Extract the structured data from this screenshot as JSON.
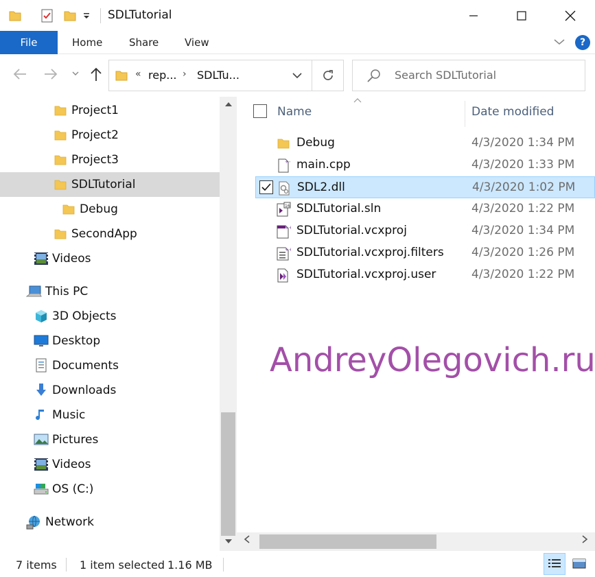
{
  "window": {
    "title": "SDLTutorial"
  },
  "ribbon": {
    "tabs": {
      "file": "File",
      "home": "Home",
      "share": "Share",
      "view": "View"
    },
    "help": "?"
  },
  "address": {
    "overflow": "«",
    "segments": [
      "rep...",
      "SDLTu..."
    ],
    "separator": "›"
  },
  "search": {
    "placeholder": "Search SDLTutorial"
  },
  "nav": {
    "items": [
      {
        "label": "Project1",
        "icon": "folder-icon"
      },
      {
        "label": "Project2",
        "icon": "folder-icon"
      },
      {
        "label": "Project3",
        "icon": "folder-icon"
      },
      {
        "label": "SDLTutorial",
        "icon": "folder-icon",
        "selected": true
      },
      {
        "label": "Debug",
        "icon": "folder-icon"
      },
      {
        "label": "SecondApp",
        "icon": "folder-icon"
      },
      {
        "label": "Videos",
        "icon": "videos-icon"
      },
      {
        "label": "This PC",
        "icon": "computer-icon"
      },
      {
        "label": "3D Objects",
        "icon": "3d-objects-icon"
      },
      {
        "label": "Desktop",
        "icon": "desktop-icon"
      },
      {
        "label": "Documents",
        "icon": "documents-icon"
      },
      {
        "label": "Downloads",
        "icon": "downloads-icon"
      },
      {
        "label": "Music",
        "icon": "music-icon"
      },
      {
        "label": "Pictures",
        "icon": "pictures-icon"
      },
      {
        "label": "Videos",
        "icon": "videos-icon"
      },
      {
        "label": "OS (C:)",
        "icon": "drive-icon"
      },
      {
        "label": "Network",
        "icon": "network-icon"
      }
    ]
  },
  "columns": {
    "name": "Name",
    "date": "Date modified"
  },
  "files": [
    {
      "name": "Debug",
      "date": "4/3/2020 1:34 PM",
      "icon": "folder-icon"
    },
    {
      "name": "main.cpp",
      "date": "4/3/2020 1:33 PM",
      "icon": "cpp-file-icon"
    },
    {
      "name": "SDL2.dll",
      "date": "4/3/2020 1:02 PM",
      "icon": "dll-file-icon",
      "selected": true
    },
    {
      "name": "SDLTutorial.sln",
      "date": "4/3/2020 1:22 PM",
      "icon": "solution-file-icon"
    },
    {
      "name": "SDLTutorial.vcxproj",
      "date": "4/3/2020 1:34 PM",
      "icon": "project-file-icon"
    },
    {
      "name": "SDLTutorial.vcxproj.filters",
      "date": "4/3/2020 1:26 PM",
      "icon": "filters-file-icon"
    },
    {
      "name": "SDLTutorial.vcxproj.user",
      "date": "4/3/2020 1:22 PM",
      "icon": "user-file-icon"
    }
  ],
  "watermark": "AndreyOlegovich.ru",
  "status": {
    "item_count": "7 items",
    "selection": "1 item selected",
    "size": "1.16 MB"
  },
  "colors": {
    "accent": "#1a68c7",
    "selection_bg": "#cce8ff",
    "watermark": "#a34fa8",
    "folder": "#f4c653"
  }
}
